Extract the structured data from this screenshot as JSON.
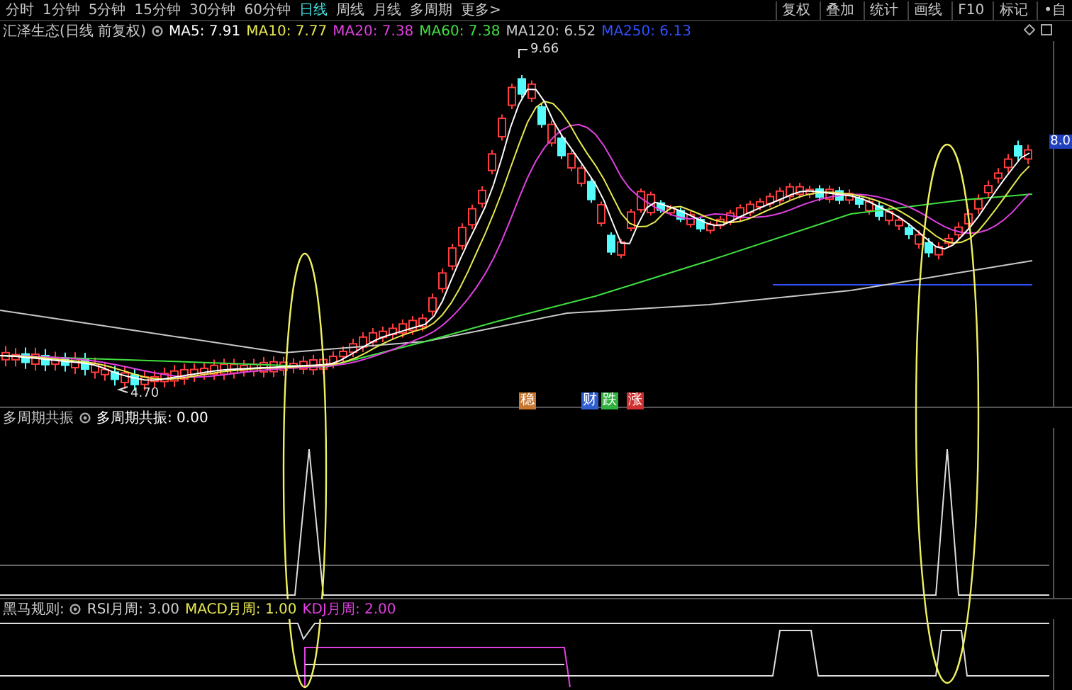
{
  "toolbar": {
    "periods": [
      {
        "label": "分时",
        "selected": false
      },
      {
        "label": "1分钟",
        "selected": false
      },
      {
        "label": "5分钟",
        "selected": false
      },
      {
        "label": "15分钟",
        "selected": false
      },
      {
        "label": "30分钟",
        "selected": false
      },
      {
        "label": "60分钟",
        "selected": false
      },
      {
        "label": "日线",
        "selected": true
      },
      {
        "label": "周线",
        "selected": false
      },
      {
        "label": "月线",
        "selected": false
      },
      {
        "label": "多周期",
        "selected": false
      },
      {
        "label": "更多>",
        "selected": false
      }
    ],
    "tools": [
      "复权",
      "叠加",
      "统计",
      "画线",
      "F10",
      "标记",
      "•自"
    ]
  },
  "main_chart": {
    "title": "汇泽生态(日线 前复权)",
    "indicators": [
      {
        "label": "MA5: 7.91",
        "color": "#ffffff"
      },
      {
        "label": "MA10: 7.77",
        "color": "#e8e850"
      },
      {
        "label": "MA20: 7.38",
        "color": "#e040e0"
      },
      {
        "label": "MA60: 7.38",
        "color": "#40e040"
      },
      {
        "label": "MA120: 6.52",
        "color": "#c8c8c8"
      },
      {
        "label": "MA250: 6.13",
        "color": "#3050ff"
      }
    ],
    "high_label": "9.66",
    "low_label": "4.70",
    "last_price": "8.0",
    "signals": [
      {
        "label": "稳",
        "color": "#c87830"
      },
      {
        "label": "财",
        "color": "#3060d0"
      },
      {
        "label": "跌",
        "color": "#30b040"
      },
      {
        "label": "涨",
        "color": "#d03030"
      }
    ]
  },
  "panel_2": {
    "title": "多周期共振",
    "indicators": [
      {
        "label": "多周期共振: 0.00",
        "color": "#ffffff"
      }
    ]
  },
  "panel_3": {
    "title": "黑马规则:",
    "indicators": [
      {
        "label": "RSI月周: 3.00",
        "color": "#d0d0d0"
      },
      {
        "label": "MACD月周: 1.00",
        "color": "#e8e850"
      },
      {
        "label": "KDJ月周: 2.00",
        "color": "#e040e0"
      }
    ]
  }
}
